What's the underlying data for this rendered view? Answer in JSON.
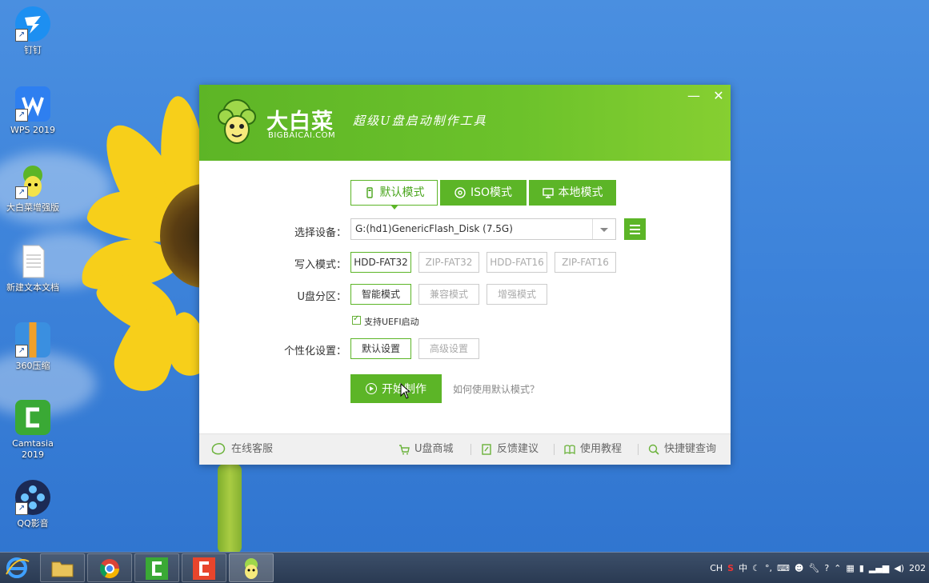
{
  "desktop": {
    "icons": [
      {
        "label": "钉钉",
        "icon": "dingtalk-icon"
      },
      {
        "label": "WPS 2019",
        "icon": "wps-icon"
      },
      {
        "label": "大白菜增强版",
        "icon": "dabaicai-icon"
      },
      {
        "label": "新建文本文档",
        "icon": "text-document-icon"
      },
      {
        "label": "360压缩",
        "icon": "360zip-icon"
      },
      {
        "label": "Camtasia 2019",
        "icon": "camtasia-icon"
      },
      {
        "label": "QQ影音",
        "icon": "qqplayer-icon"
      }
    ]
  },
  "window": {
    "brand_cn": "大白菜",
    "brand_en": "BIGBAICAI.COM",
    "slogan": "超级U盘启动制作工具",
    "minimize": "—",
    "close": "✕",
    "tabs": [
      {
        "label": "默认模式",
        "icon": "usb-icon",
        "active": true
      },
      {
        "label": "ISO模式",
        "icon": "disc-icon",
        "active": false
      },
      {
        "label": "本地模式",
        "icon": "monitor-icon",
        "active": false
      }
    ],
    "device_label": "选择设备：",
    "device_value": "G:(hd1)GenericFlash_Disk (7.5G)",
    "write_mode_label": "写入模式：",
    "write_modes": [
      "HDD-FAT32",
      "ZIP-FAT32",
      "HDD-FAT16",
      "ZIP-FAT16"
    ],
    "write_mode_selected": "HDD-FAT32",
    "partition_label": "U盘分区：",
    "partition_modes": [
      "智能模式",
      "兼容模式",
      "增强模式"
    ],
    "partition_selected": "智能模式",
    "uefi_label": "支持UEFI启动",
    "uefi_checked": true,
    "personal_label": "个性化设置：",
    "personal_options": [
      "默认设置",
      "高级设置"
    ],
    "personal_selected": "默认设置",
    "start_label": "开始制作",
    "help_link": "如何使用默认模式？",
    "footer": {
      "online_service": "在线客服",
      "shop": "U盘商城",
      "feedback": "反馈建议",
      "tutorial": "使用教程",
      "shortcut": "快捷键查询"
    },
    "accent": "#5cb527"
  },
  "taskbar": {
    "apps": [
      "ie-icon",
      "file-explorer-icon",
      "chrome-icon",
      "camtasia-icon",
      "camtasia-recorder-icon",
      "dabaicai-icon"
    ],
    "tray": {
      "lang": "CH",
      "ime": "中",
      "clock": "202"
    }
  }
}
